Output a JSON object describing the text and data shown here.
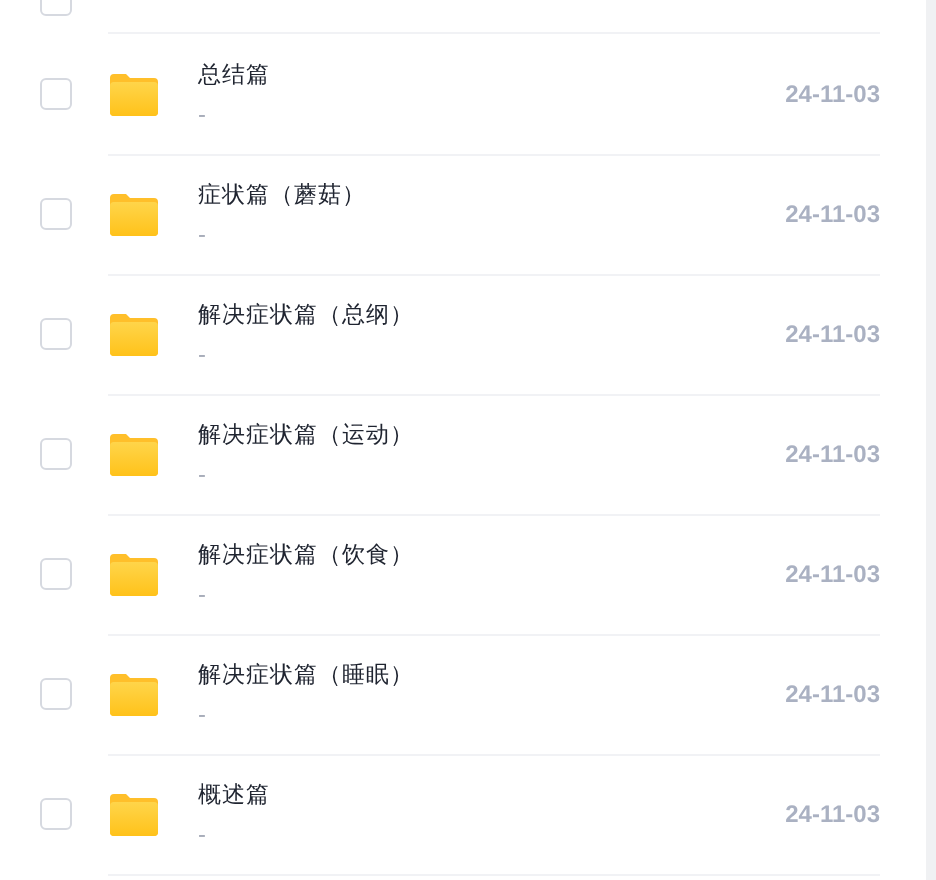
{
  "files": [
    {
      "name": "总结篇",
      "description": "-",
      "date": "24-11-03",
      "checked": false
    },
    {
      "name": "症状篇（蘑菇）",
      "description": "-",
      "date": "24-11-03",
      "checked": false
    },
    {
      "name": "解决症状篇（总纲）",
      "description": "-",
      "date": "24-11-03",
      "checked": false
    },
    {
      "name": "解决症状篇（运动）",
      "description": "-",
      "date": "24-11-03",
      "checked": false
    },
    {
      "name": "解决症状篇（饮食）",
      "description": "-",
      "date": "24-11-03",
      "checked": false
    },
    {
      "name": "解决症状篇（睡眠）",
      "description": "-",
      "date": "24-11-03",
      "checked": false
    },
    {
      "name": "概述篇",
      "description": "-",
      "date": "24-11-03",
      "checked": false
    }
  ]
}
